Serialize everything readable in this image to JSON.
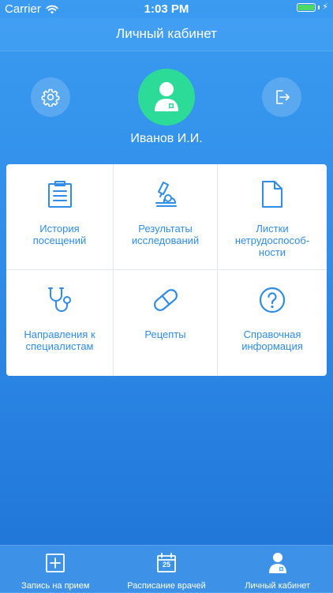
{
  "status_bar": {
    "carrier": "Carrier",
    "time": "1:03 PM",
    "battery_level": 1.0
  },
  "nav": {
    "title": "Личный кабинет"
  },
  "profile": {
    "name": "Иванов И.И."
  },
  "grid": [
    {
      "label": "История\nпосещений",
      "icon": "document-list-icon"
    },
    {
      "label": "Результаты\nисследований",
      "icon": "microscope-icon"
    },
    {
      "label": "Листки\nнетрудоспособ-\nности",
      "icon": "file-icon"
    },
    {
      "label": "Направления к\nспециалистам",
      "icon": "stethoscope-icon"
    },
    {
      "label": "Рецепты",
      "icon": "pill-icon"
    },
    {
      "label": "Справочная\nинформация",
      "icon": "question-circle-icon"
    }
  ],
  "tabs": [
    {
      "label": "Запись на прием",
      "icon": "plus-square-icon"
    },
    {
      "label": "Расписание врачей",
      "icon": "calendar-icon",
      "calendar_day": "25"
    },
    {
      "label": "Личный кабинет",
      "icon": "user-icon",
      "active": true
    }
  ],
  "colors": {
    "accent": "#2f8ce8",
    "avatar": "#2ddb98",
    "battery": "#4cd964"
  }
}
